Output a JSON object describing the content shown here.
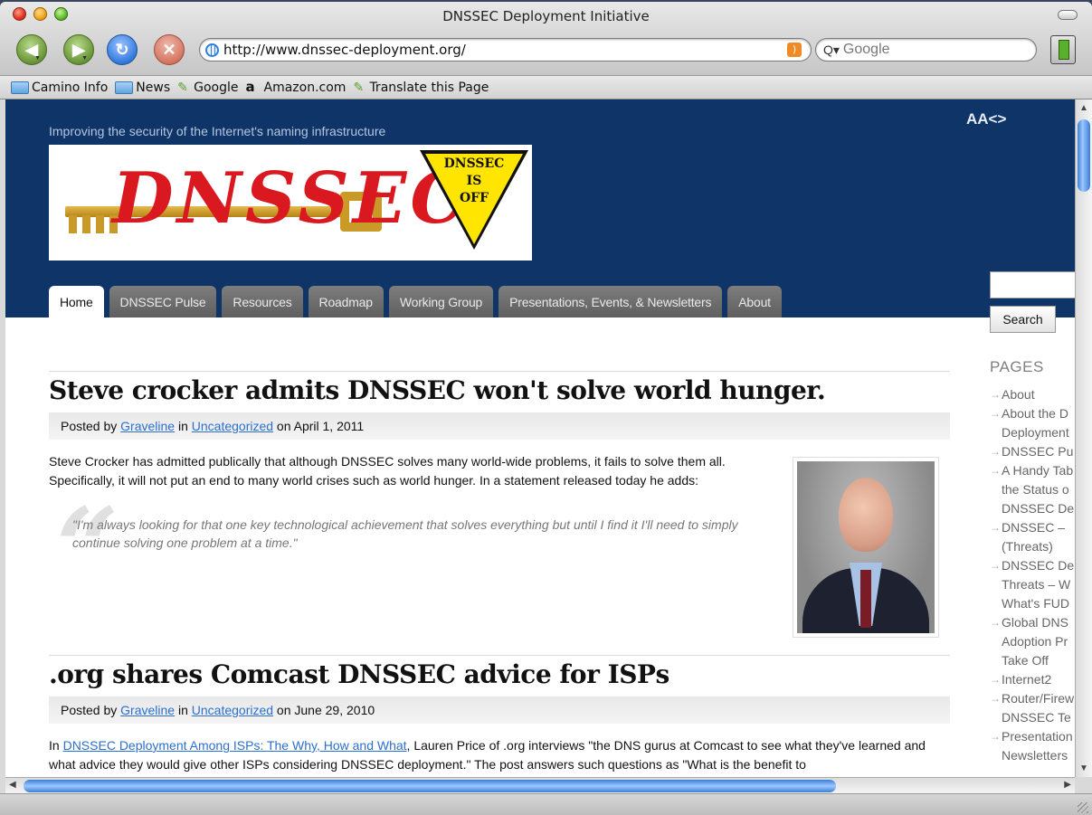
{
  "window": {
    "title": "DNSSEC Deployment Initiative"
  },
  "toolbar": {
    "url": "http://www.dnssec-deployment.org/",
    "search_placeholder": "Google"
  },
  "bookmarks": [
    {
      "label": "Camino Info",
      "icon": "folder-icon"
    },
    {
      "label": "News",
      "icon": "folder-icon"
    },
    {
      "label": "Google",
      "icon": "leaf-icon"
    },
    {
      "label": "Amazon.com",
      "icon": "amazon-icon"
    },
    {
      "label": "Translate this Page",
      "icon": "leaf-icon"
    }
  ],
  "site": {
    "tagline": "Improving the security of the Internet's naming infrastructure",
    "font_resize": "AA<>",
    "logo_word": "DNSSEC",
    "sign_lines": [
      "DNSSEC",
      "IS",
      "OFF"
    ],
    "tabs": [
      "Home",
      "DNSSEC Pulse",
      "Resources",
      "Roadmap",
      "Working Group",
      "Presentations, Events, & Newsletters",
      "About"
    ],
    "search_button": "Search"
  },
  "posts": [
    {
      "title": "Steve crocker admits DNSSEC won't solve world hunger.",
      "meta_prefix": "Posted by ",
      "author": "Graveline",
      "meta_in": " in ",
      "category": "Uncategorized",
      "meta_on": " on April 1, 2011",
      "body": "Steve Crocker has admitted publically that although DNSSEC solves many world-wide problems, it fails to solve them all. Specifically, it will not put an end to many world crises such as world hunger. In a statement released today he adds:",
      "quote": "\"I'm always looking for that one key technological achievement that solves everything but until I find it I'll need to simply continue solving one problem at a time.\""
    },
    {
      "title": ".org shares Comcast DNSSEC advice for ISPs",
      "meta_prefix": "Posted by ",
      "author": "Graveline",
      "meta_in": " in ",
      "category": "Uncategorized",
      "meta_on": " on June 29, 2010",
      "body_prefix": "In ",
      "body_link": "DNSSEC Deployment Among ISPs: The Why, How and What",
      "body_rest": ", Lauren Price of .org interviews \"the DNS gurus at Comcast to see what they've learned and what advice they would give other ISPs considering DNSSEC deployment.\" The post answers such questions as \"What is the benefit to"
    }
  ],
  "sidebar": {
    "title": "PAGES",
    "items": [
      [
        "About"
      ],
      [
        "About the D",
        "Deployment"
      ],
      [
        "DNSSEC Pu"
      ],
      [
        "A Handy Tab",
        "the Status o",
        "DNSSEC De"
      ],
      [
        "DNSSEC –",
        "(Threats)"
      ],
      [
        "DNSSEC De",
        "Threats – W",
        "What's FUD"
      ],
      [
        "Global DNS",
        "Adoption Pr",
        "Take Off"
      ],
      [
        "Internet2"
      ],
      [
        "Router/Firew",
        "DNSSEC Te"
      ],
      [
        "Presentation",
        "Newsletters"
      ]
    ]
  },
  "colors": {
    "header": "#0f3467",
    "link": "#2b6fd0",
    "tab": "#6f6f6f"
  }
}
